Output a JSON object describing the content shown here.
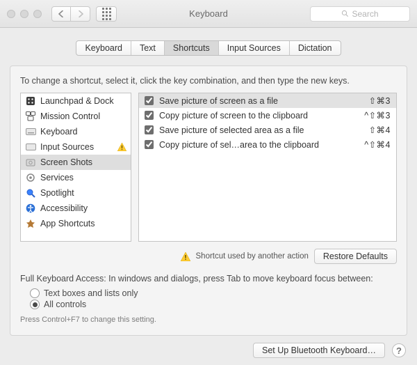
{
  "window": {
    "title": "Keyboard",
    "search_placeholder": "Search"
  },
  "tabs": [
    {
      "label": "Keyboard",
      "active": false
    },
    {
      "label": "Text",
      "active": false
    },
    {
      "label": "Shortcuts",
      "active": true
    },
    {
      "label": "Input Sources",
      "active": false
    },
    {
      "label": "Dictation",
      "active": false
    }
  ],
  "instructions": "To change a shortcut, select it, click the key combination, and then type the new keys.",
  "sidebar": {
    "items": [
      {
        "label": "Launchpad & Dock",
        "icon": "launchpad-icon"
      },
      {
        "label": "Mission Control",
        "icon": "mission-control-icon"
      },
      {
        "label": "Keyboard",
        "icon": "keyboard-icon"
      },
      {
        "label": "Input Sources",
        "icon": "input-sources-icon",
        "warning": true
      },
      {
        "label": "Screen Shots",
        "icon": "screenshot-icon",
        "selected": true
      },
      {
        "label": "Services",
        "icon": "services-icon"
      },
      {
        "label": "Spotlight",
        "icon": "spotlight-icon"
      },
      {
        "label": "Accessibility",
        "icon": "accessibility-icon"
      },
      {
        "label": "App Shortcuts",
        "icon": "app-shortcuts-icon"
      }
    ]
  },
  "shortcuts": [
    {
      "checked": true,
      "label": "Save picture of screen as a file",
      "keys": "⇧⌘3",
      "highlighted": true
    },
    {
      "checked": true,
      "label": "Copy picture of screen to the clipboard",
      "keys": "^⇧⌘3"
    },
    {
      "checked": true,
      "label": "Save picture of selected area as a file",
      "keys": "⇧⌘4"
    },
    {
      "checked": true,
      "label": "Copy picture of sel…area to the clipboard",
      "keys": "^⇧⌘4"
    }
  ],
  "notice": "Shortcut used by another action",
  "restore_defaults": "Restore Defaults",
  "fka": {
    "prompt": "Full Keyboard Access: In windows and dialogs, press Tab to move keyboard focus between:",
    "options": [
      {
        "label": "Text boxes and lists only",
        "checked": false
      },
      {
        "label": "All controls",
        "checked": true
      }
    ],
    "hint": "Press Control+F7 to change this setting."
  },
  "footer": {
    "bluetooth_button": "Set Up Bluetooth Keyboard…"
  }
}
